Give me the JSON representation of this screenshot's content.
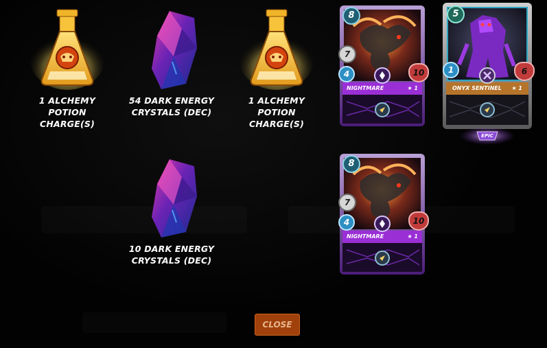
{
  "rewards": [
    {
      "caption_line1": "1 ALCHEMY POTION",
      "caption_line2": "CHARGE(S)",
      "icon": "alchemy-potion-icon"
    },
    {
      "caption_line1": "54 DARK ENERGY",
      "caption_line2": "CRYSTALS (DEC)",
      "icon": "dark-energy-crystal-icon"
    },
    {
      "caption_line1": "1 ALCHEMY POTION",
      "caption_line2": "CHARGE(S)",
      "icon": "alchemy-potion-icon"
    },
    {
      "caption_line1": "10 DARK ENERGY",
      "caption_line2": "CRYSTALS (DEC)",
      "icon": "dark-energy-crystal-icon"
    }
  ],
  "cards": [
    {
      "name": "NIGHTMARE",
      "level": "★ 1",
      "mana": "8",
      "attack": "7",
      "speed": "4",
      "health": "10"
    },
    {
      "name": "ONYX SENTINEL",
      "level": "★ 1",
      "mana": "5",
      "speed": "1",
      "health": "6",
      "rarity_badge": "EPIC"
    },
    {
      "name": "NIGHTMARE",
      "level": "★ 1",
      "mana": "8",
      "attack": "7",
      "speed": "4",
      "health": "10"
    }
  ],
  "close_button": {
    "label": "CLOSE"
  },
  "colors": {
    "close_bg": "#a0400b",
    "potion_gold": "#f3c53a",
    "crystal_purple": "#5d1fa8",
    "nightmare_frame": "#7a2fb8",
    "sentinel_frame": "#3aa0c0"
  }
}
